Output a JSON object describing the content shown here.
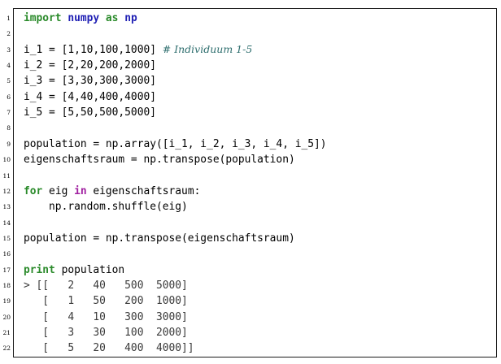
{
  "listing": {
    "lines": [
      {
        "number": "1",
        "tokens": [
          {
            "t": "import",
            "c": "kw"
          },
          {
            "t": " "
          },
          {
            "t": "numpy",
            "c": "mod"
          },
          {
            "t": " "
          },
          {
            "t": "as",
            "c": "kw"
          },
          {
            "t": " "
          },
          {
            "t": "np",
            "c": "mod"
          }
        ]
      },
      {
        "number": "2",
        "tokens": []
      },
      {
        "number": "3",
        "tokens": [
          {
            "t": "i_1 = [1,10,100,1000] "
          },
          {
            "t": "# Individuum 1-5",
            "c": "comment"
          }
        ]
      },
      {
        "number": "4",
        "tokens": [
          {
            "t": "i_2 = [2,20,200,2000]"
          }
        ]
      },
      {
        "number": "5",
        "tokens": [
          {
            "t": "i_3 = [3,30,300,3000]"
          }
        ]
      },
      {
        "number": "6",
        "tokens": [
          {
            "t": "i_4 = [4,40,400,4000]"
          }
        ]
      },
      {
        "number": "7",
        "tokens": [
          {
            "t": "i_5 = [5,50,500,5000]"
          }
        ]
      },
      {
        "number": "8",
        "tokens": []
      },
      {
        "number": "9",
        "tokens": [
          {
            "t": "population = np.array([i_1, i_2, i_3, i_4, i_5])"
          }
        ]
      },
      {
        "number": "10",
        "tokens": [
          {
            "t": "eigenschaftsraum = np.transpose(population)"
          }
        ]
      },
      {
        "number": "11",
        "tokens": []
      },
      {
        "number": "12",
        "tokens": [
          {
            "t": "for",
            "c": "kw"
          },
          {
            "t": " eig "
          },
          {
            "t": "in",
            "c": "in"
          },
          {
            "t": " eigenschaftsraum:"
          }
        ]
      },
      {
        "number": "13",
        "tokens": [
          {
            "t": "    np.random.shuffle(eig)"
          }
        ]
      },
      {
        "number": "14",
        "tokens": []
      },
      {
        "number": "15",
        "tokens": [
          {
            "t": "population = np.transpose(eigenschaftsraum)"
          }
        ]
      },
      {
        "number": "16",
        "tokens": []
      },
      {
        "number": "17",
        "tokens": [
          {
            "t": "print",
            "c": "kw"
          },
          {
            "t": " population"
          }
        ]
      },
      {
        "number": "18",
        "tokens": [
          {
            "t": "> [[   2   40   500  5000]",
            "c": "out"
          }
        ]
      },
      {
        "number": "19",
        "tokens": [
          {
            "t": "   [   1   50   200  1000]",
            "c": "out"
          }
        ]
      },
      {
        "number": "20",
        "tokens": [
          {
            "t": "   [   4   10   300  3000]",
            "c": "out"
          }
        ]
      },
      {
        "number": "21",
        "tokens": [
          {
            "t": "   [   3   30   100  2000]",
            "c": "out"
          }
        ]
      },
      {
        "number": "22",
        "tokens": [
          {
            "t": "   [   5   20   400  4000]]",
            "c": "out"
          }
        ]
      }
    ]
  },
  "colors": {
    "keyword": "#2a8a2a",
    "module": "#1f1fb4",
    "in_operator": "#a020a0",
    "comment": "#2e6e6e",
    "border": "#1a1a1a"
  }
}
